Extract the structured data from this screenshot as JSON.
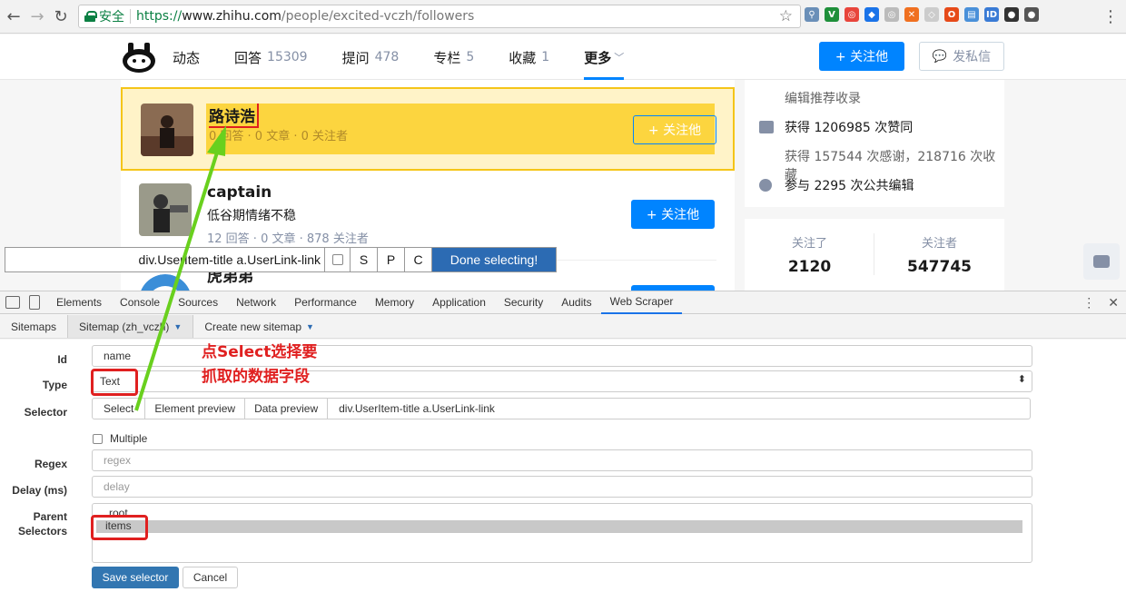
{
  "browser": {
    "secure_label": "安全",
    "url_https": "https://",
    "url_host": "www.zhihu.com",
    "url_path": "/people/excited-vczh/followers",
    "extensions": [
      {
        "name": "pin-icon",
        "color": "#6a8fb8",
        "glyph": "⚲"
      },
      {
        "name": "v-icon",
        "color": "#1e8f3a",
        "glyph": "V"
      },
      {
        "name": "red-target-icon",
        "color": "#e8453c",
        "glyph": "◎"
      },
      {
        "name": "blue-cube-icon",
        "color": "#1a73e8",
        "glyph": "◆"
      },
      {
        "name": "gray-circle-icon",
        "color": "#bbbbbb",
        "glyph": "◎"
      },
      {
        "name": "orange-icon",
        "color": "#f07020",
        "glyph": "✕"
      },
      {
        "name": "shield-icon",
        "color": "#cccccc",
        "glyph": "◇"
      },
      {
        "name": "office-icon",
        "color": "#e64a19",
        "glyph": "O"
      },
      {
        "name": "scraper-icon",
        "color": "#4a90d9",
        "glyph": "▤"
      },
      {
        "name": "id-icon",
        "color": "#3a7bd5",
        "glyph": "ID"
      },
      {
        "name": "ghost-icon",
        "color": "#333333",
        "glyph": "●"
      },
      {
        "name": "sphere-icon",
        "color": "#555555",
        "glyph": "●"
      }
    ]
  },
  "zhihu": {
    "tabs": [
      {
        "label": "动态",
        "count": ""
      },
      {
        "label": "回答",
        "count": "15309"
      },
      {
        "label": "提问",
        "count": "478"
      },
      {
        "label": "专栏",
        "count": "5"
      },
      {
        "label": "收藏",
        "count": "1"
      }
    ],
    "more_label": "更多",
    "follow_btn": "+ 关注他",
    "message_btn": "发私信",
    "followers": [
      {
        "name": "路诗浩",
        "bio": "",
        "meta": "0 回答 · 0 文章 · 0 关注者",
        "btn": "+ 关注他"
      },
      {
        "name": "captain",
        "bio": "低谷期情绪不稳",
        "meta": "12 回答 · 0 文章 · 878 关注者",
        "btn": "+ 关注他"
      },
      {
        "name": "虎弟弟",
        "bio": "",
        "meta": "",
        "btn": ""
      }
    ],
    "sidebar": {
      "recommend": "编辑推荐收录",
      "likes": "获得 1206985 次赞同",
      "thanks": "获得 157544 次感谢，218716 次收藏",
      "edits": "参与 2295 次公共编辑",
      "following_label": "关注了",
      "following_value": "2120",
      "followers_label": "关注者",
      "followers_value": "547745"
    }
  },
  "selection_toolbar": {
    "selector_value": "div.UserItem-title a.UserLink-link",
    "keys": [
      "S",
      "P",
      "C"
    ],
    "done_label": "Done selecting!"
  },
  "devtools": {
    "tabs": [
      "Elements",
      "Console",
      "Sources",
      "Network",
      "Performance",
      "Memory",
      "Application",
      "Security",
      "Audits",
      "Web Scraper"
    ]
  },
  "web_scraper": {
    "tabs": [
      {
        "label": "Sitemaps",
        "caret": ""
      },
      {
        "label": "Sitemap (zh_vczh)",
        "caret": "▼"
      },
      {
        "label": "Create new sitemap",
        "caret": "▼"
      }
    ],
    "labels": {
      "id": "Id",
      "type": "Type",
      "selector": "Selector",
      "regex": "Regex",
      "delay": "Delay (ms)",
      "parent": "Parent Selectors"
    },
    "id_value": "name",
    "type_value": "Text",
    "selector_buttons": [
      "Select",
      "Element preview",
      "Data preview"
    ],
    "selector_value": "div.UserItem-title a.UserLink-link",
    "multiple_label": "Multiple",
    "regex_placeholder": "regex",
    "delay_placeholder": "delay",
    "parent_options": [
      "root",
      "items"
    ],
    "save_label": "Save selector",
    "cancel_label": "Cancel"
  },
  "annotation": {
    "line1": "点Select选择要",
    "line2": "抓取的数据字段"
  }
}
